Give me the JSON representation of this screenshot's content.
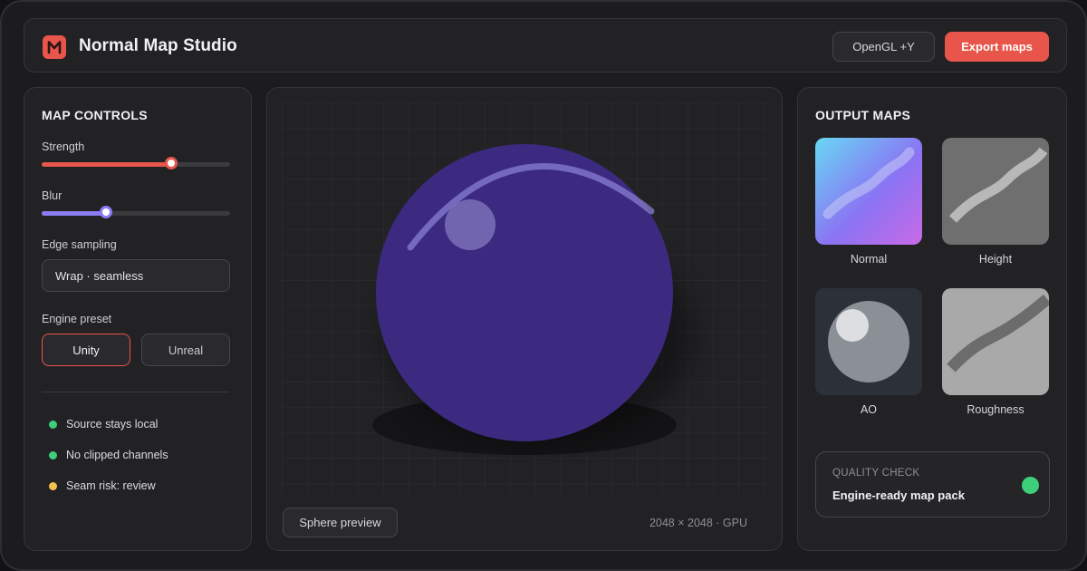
{
  "app": {
    "title": "Normal Map Studio",
    "logo_letter": "M",
    "accent": "#e8554a"
  },
  "toolbar": {
    "coordinate_label": "OpenGL +Y",
    "export_label": "Export maps"
  },
  "controls": {
    "title": "MAP CONTROLS",
    "strength": {
      "label": "Strength",
      "value": 0.7,
      "color": "#e8554a"
    },
    "blur": {
      "label": "Blur",
      "value": 0.35,
      "color": "#8b7cf6"
    },
    "edge_sampling": {
      "label": "Edge sampling",
      "value": "Wrap · seamless"
    },
    "engine_preset": {
      "label": "Engine preset",
      "options": [
        "Unity",
        "Unreal"
      ],
      "selected": "Unity"
    },
    "status": [
      {
        "text": "Source stays local",
        "color": "#3ecf7a"
      },
      {
        "text": "No clipped channels",
        "color": "#3ecf7a"
      },
      {
        "text": "Seam risk: review",
        "color": "#f2c14e"
      }
    ]
  },
  "preview": {
    "mode_button": "Sphere preview",
    "resolution": "2048 × 2048 · GPU",
    "sphere_color": "#3b2a80"
  },
  "output": {
    "title": "OUTPUT MAPS",
    "maps": [
      {
        "label": "Normal",
        "icon": "normal-map-thumbnail"
      },
      {
        "label": "Height",
        "icon": "height-map-thumbnail"
      },
      {
        "label": "AO",
        "icon": "ao-map-thumbnail"
      },
      {
        "label": "Roughness",
        "icon": "roughness-map-thumbnail"
      }
    ],
    "quality": {
      "eyebrow": "QUALITY CHECK",
      "title": "Engine-ready map pack",
      "indicator_color": "#3ecf7a"
    }
  }
}
